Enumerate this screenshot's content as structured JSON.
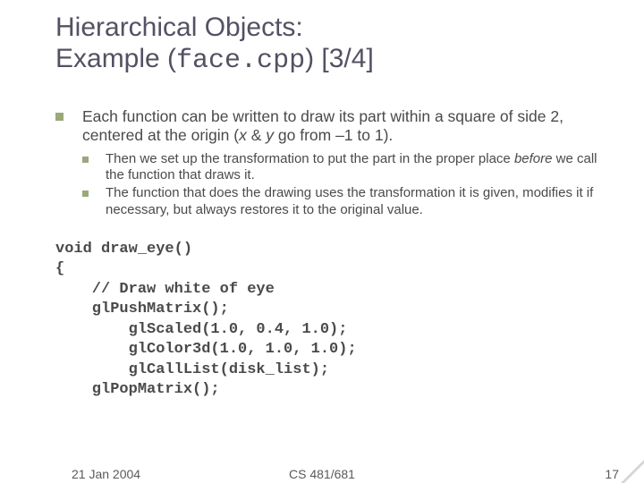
{
  "title": {
    "line1a": "Hierarchical Objects:",
    "line2a": "Example (",
    "line2code": "face.cpp",
    "line2b": ") [3/4]"
  },
  "bullets": {
    "lvl1": {
      "pre": "Each function can be written to draw its part within a square of side 2, centered at the origin (",
      "var1": "x",
      "amp": " & ",
      "var2": "y",
      "post": " go from –1 to 1)."
    },
    "lvl2a": {
      "pre": "Then we set up the transformation to put the part in the proper place ",
      "ital": "before",
      "post": " we call the function that draws it."
    },
    "lvl2b": "The function that does the drawing uses the transformation it is given, modifies it if necessary, but always restores it to the original value."
  },
  "code": {
    "l1": "void draw_eye()",
    "l2": "{",
    "l3": "    // Draw white of eye",
    "l4": "    glPushMatrix();",
    "l5": "        glScaled(1.0, 0.4, 1.0);",
    "l6": "        glColor3d(1.0, 1.0, 1.0);",
    "l7": "        glCallList(disk_list);",
    "l8": "    glPopMatrix();"
  },
  "footer": {
    "date": "21 Jan 2004",
    "course": "CS 481/681",
    "page": "17"
  }
}
